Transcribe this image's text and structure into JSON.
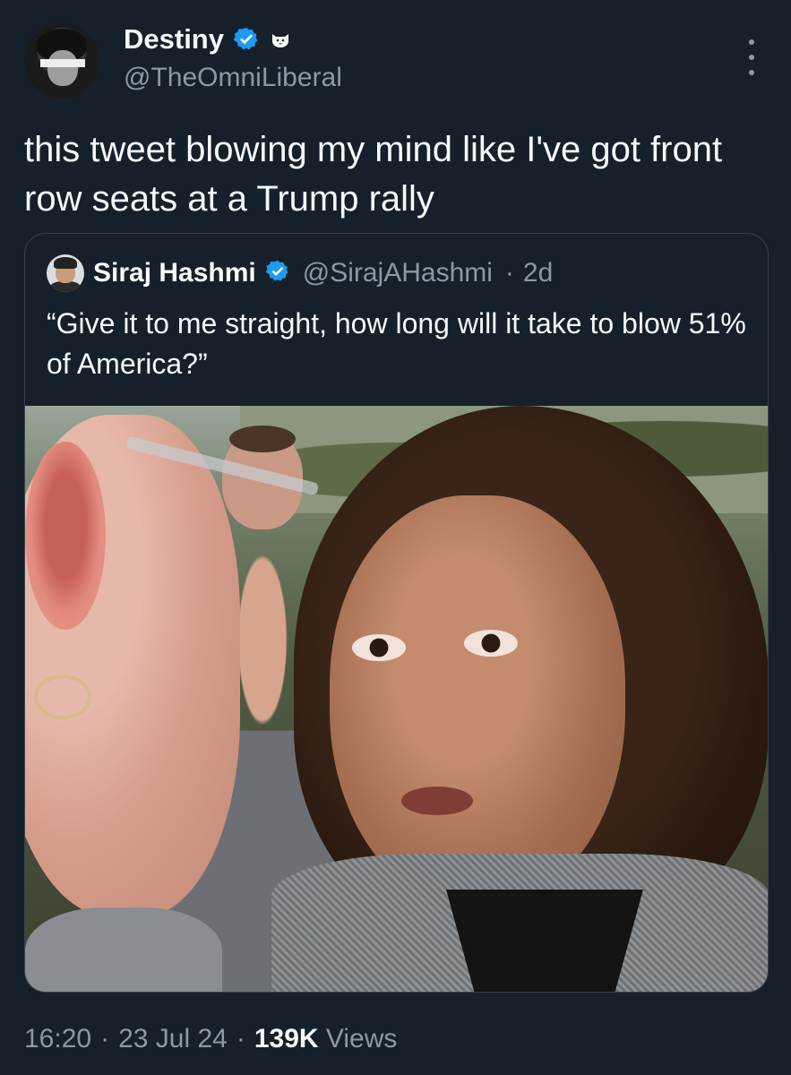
{
  "author": {
    "display_name": "Destiny",
    "handle": "@TheOmniLiberal",
    "verified": true,
    "affiliate_badge_icon": "cat-badge-icon"
  },
  "tweet": {
    "text": "this tweet blowing my mind like I've got front row seats at a Trump rally"
  },
  "quoted": {
    "display_name": "Siraj Hashmi",
    "handle": "@SirajAHashmi",
    "separator": "·",
    "age": "2d",
    "text": "“Give it to me straight, how long will it take to blow 51% of America?”"
  },
  "footer": {
    "time": "16:20",
    "sep1": "·",
    "date": "23 Jul 24",
    "sep2": "·",
    "views_count": "139K",
    "views_label": "Views"
  },
  "colors": {
    "background": "#15202b",
    "verified": "#1d9bf0",
    "secondary_text": "#8b98a5",
    "border": "#38444d"
  }
}
